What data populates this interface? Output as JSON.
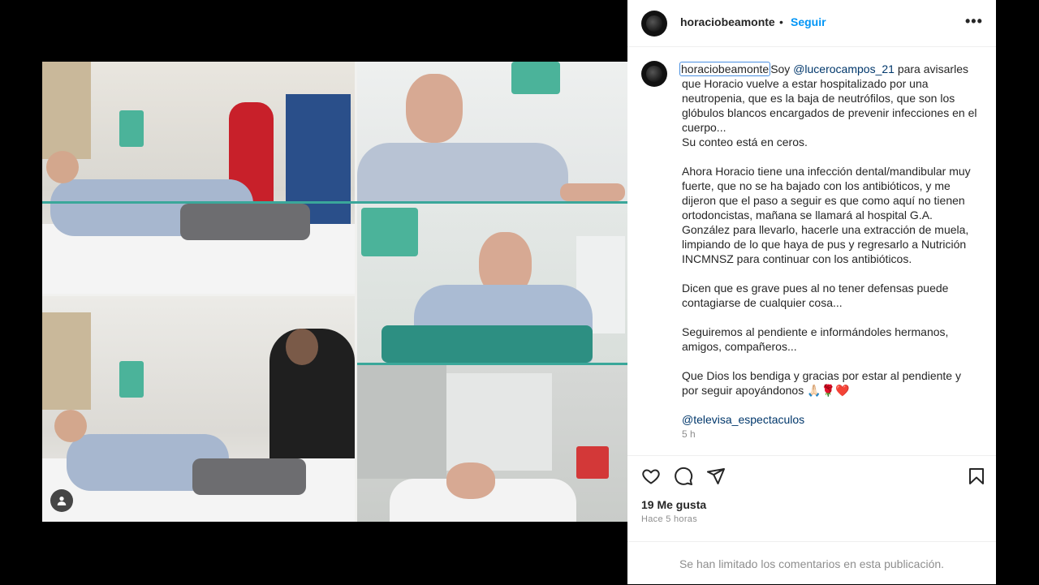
{
  "post": {
    "username": "horaciobeamonte",
    "separator": "•",
    "follow_label": "Seguir",
    "more_label": "•••"
  },
  "caption": {
    "username": "horaciobeamonte",
    "p1_pre": "Soy ",
    "mention": "@lucerocampos_21",
    "p1_post": " para avisarles que Horacio vuelve a estar hospitalizado por una neutropenia, que es la baja de neutrófilos, que son los glóbulos blancos encargados de prevenir infecciones en el cuerpo...",
    "p1_line2": "Su conteo está en ceros.",
    "p2": "Ahora Horacio tiene una infección dental/mandibular muy fuerte, que no se ha bajado con los antibióticos, y me dijeron que el paso a seguir es que como aquí no tienen ortodoncistas, mañana se llamará al hospital G.A. González para llevarlo, hacerle una extracción de muela, limpiando de lo que haya de pus y regresarlo a Nutrición INCMNSZ para continuar con los antibióticos.",
    "p3": "Dicen que es grave pues al no tener defensas puede contagiarse de cualquier cosa...",
    "p4": "Seguiremos al pendiente e informándoles hermanos, amigos, compañeros...",
    "p5": "Que Dios los bendiga y gracias por estar al pendiente y por seguir apoyándonos 🙏🏻🌹❤️",
    "tag": "@televisa_espectaculos",
    "time": "5 h"
  },
  "stats": {
    "likes": "19 Me gusta",
    "posted": "Hace 5 horas"
  },
  "comments_notice": "Se han limitado los comentarios en esta publicación.",
  "icons": {
    "like": "heart-icon",
    "comment": "comment-icon",
    "share": "send-icon",
    "save": "bookmark-icon",
    "account": "user-icon"
  },
  "colors": {
    "follow": "#0095f6",
    "link": "#00376b",
    "muted": "#8e8e8e"
  }
}
